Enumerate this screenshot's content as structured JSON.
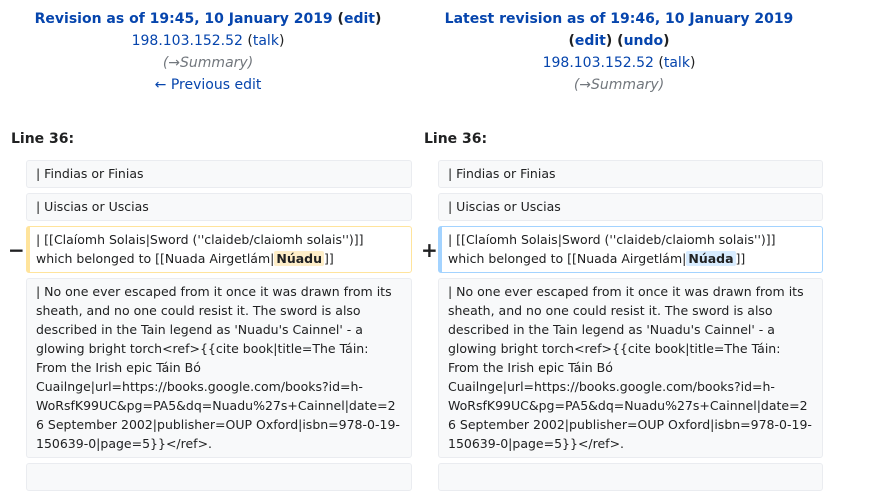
{
  "left_header": {
    "title": "Revision as of 19:45, 10 January 2019",
    "edit": "edit",
    "user": "198.103.152.52",
    "talk": "talk",
    "summary_arrow": "→",
    "summary": "Summary",
    "prev_edit": "← Previous edit"
  },
  "right_header": {
    "title": "Latest revision as of 19:46, 10 January 2019",
    "edit": "edit",
    "undo": "undo",
    "user": "198.103.152.52",
    "talk": "talk",
    "summary_arrow": "→",
    "summary": "Summary"
  },
  "line_label": "Line 36:",
  "markers": {
    "removed": "−",
    "added": "+"
  },
  "rows": {
    "findias": "| Findias or Finias",
    "uiscias": "| Uiscias or Uscias",
    "claiomh_prefix": "| [[Claíomh Solais|Sword (''claideb/claiomh solais'')]] which belonged to [[Nuada Airgetlám|",
    "claiomh_old_word": "Núadu",
    "claiomh_new_word": "Núada",
    "claiomh_suffix": "]]",
    "escaped": "| No one ever escaped from it once it was drawn from its sheath, and no one could resist it. The sword is also described in the Tain legend as 'Nuadu's Cainnel' - a glowing bright torch<ref>{{cite book|title=The Táin: From the Irish epic Táin Bó Cuailnge|url=https://books.google.com/books?id=h-WoRsfK99UC&pg=PA5&dq=Nuadu%27s+Cainnel|date=26 September 2002|publisher=OUP Oxford|isbn=978-0-19-150639-0|page=5}}</ref>."
  }
}
